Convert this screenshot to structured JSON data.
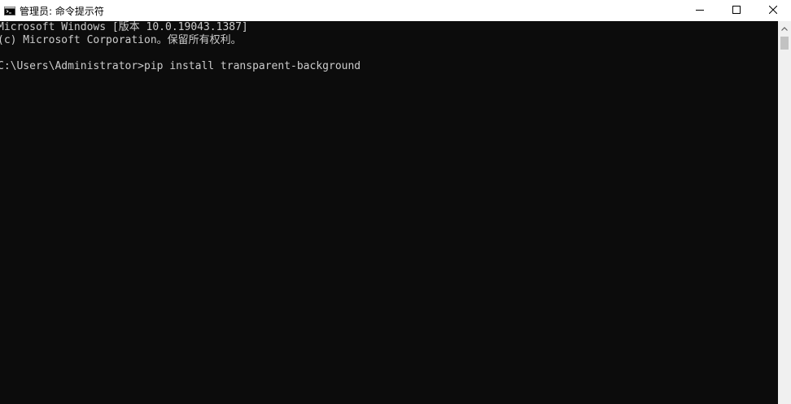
{
  "window": {
    "title": "管理员: 命令提示符"
  },
  "console": {
    "lines": [
      "Microsoft Windows [版本 10.0.19043.1387]",
      "(c) Microsoft Corporation。保留所有权利。",
      "",
      "C:\\Users\\Administrator>pip install transparent-background"
    ]
  },
  "colors": {
    "background": "#0c0c0c",
    "text": "#cccccc",
    "titlebar": "#ffffff",
    "scrollbar": "#f0f0f0"
  },
  "icons": {
    "app": "cmd-icon",
    "minimize": "minimize-icon",
    "maximize": "maximize-icon",
    "close": "close-icon",
    "scroll_up": "chevron-up-icon"
  }
}
